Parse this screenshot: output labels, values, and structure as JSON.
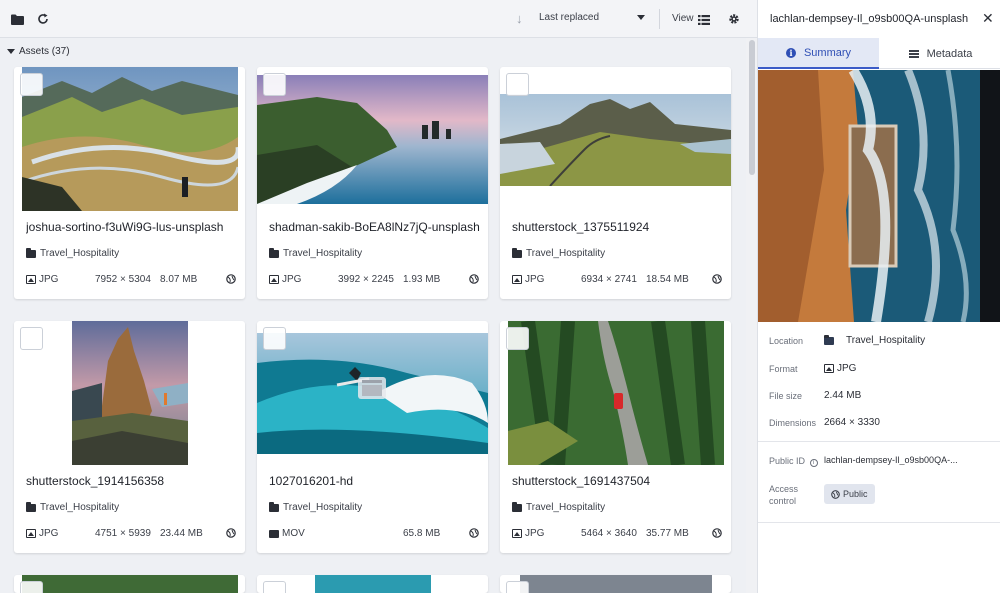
{
  "toolbar": {
    "sort_label": "Last replaced",
    "view_label": "View",
    "icons": [
      "folder-icon",
      "refresh-icon",
      "sort-direction-icon",
      "list-view-icon",
      "gear-icon"
    ]
  },
  "assets": {
    "header": "Assets (37)"
  },
  "cards": [
    {
      "title": "joshua-sortino-f3uWi9G-lus-unsplash",
      "folder": "Travel_Hospitality",
      "format": "JPG",
      "dims": "7952 × 5304",
      "size": "8.07 MB",
      "kind": "image"
    },
    {
      "title": "shadman-sakib-BoEA8lNz7jQ-unsplash",
      "folder": "Travel_Hospitality",
      "format": "JPG",
      "dims": "3992 × 2245",
      "size": "1.93 MB",
      "kind": "image"
    },
    {
      "title": "shutterstock_1375511924",
      "folder": "Travel_Hospitality",
      "format": "JPG",
      "dims": "6934 × 2741",
      "size": "18.54 MB",
      "kind": "image"
    },
    {
      "title": "shutterstock_1914156358",
      "folder": "Travel_Hospitality",
      "format": "JPG",
      "dims": "4751 × 5939",
      "size": "23.44 MB",
      "kind": "image"
    },
    {
      "title": "1027016201-hd",
      "folder": "Travel_Hospitality",
      "format": "MOV",
      "dims": "",
      "size": "65.8 MB",
      "kind": "video"
    },
    {
      "title": "shutterstock_1691437504",
      "folder": "Travel_Hospitality",
      "format": "JPG",
      "dims": "5464 × 3640",
      "size": "35.77 MB",
      "kind": "image"
    }
  ],
  "panel": {
    "title": "lachlan-dempsey-Il_o9sb00QA-unsplash",
    "tabs": {
      "summary": "Summary",
      "metadata": "Metadata"
    },
    "location_label": "Location",
    "location_value": "Travel_Hospitality",
    "format_label": "Format",
    "format_value": "JPG",
    "filesize_label": "File size",
    "filesize_value": "2.44 MB",
    "dimensions_label": "Dimensions",
    "dimensions_value": "2664 × 3330",
    "publicid_label": "Public ID",
    "publicid_value": "lachlan-dempsey-Il_o9sb00QA-...",
    "access_label": "Access control",
    "access_value": "Public"
  },
  "colors": {
    "accent": "#3b5bc7",
    "tab_active_bg": "#e3e8f5",
    "background": "#eef0f4"
  }
}
